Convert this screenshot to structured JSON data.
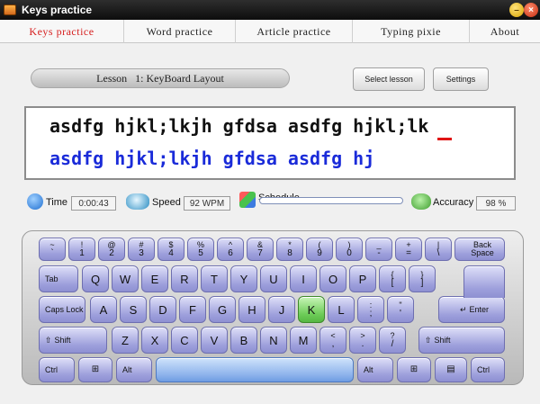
{
  "app": {
    "title": "Keys practice"
  },
  "tabs": [
    {
      "label": "Keys practice",
      "active": true
    },
    {
      "label": "Word practice",
      "active": false
    },
    {
      "label": "Article practice",
      "active": false
    },
    {
      "label": "Typing pixie",
      "active": false
    },
    {
      "label": "About",
      "active": false
    }
  ],
  "lesson": {
    "text": "Lesson   1: KeyBoard Layout"
  },
  "buttons": {
    "select_lesson": "Select lesson",
    "settings": "Settings"
  },
  "practice": {
    "target_text": "asdfg hjkl;lkjh gfdsa asdfg hjkl;lk",
    "typed_text": "asdfg hjkl;lkjh gfdsa asdfg hj"
  },
  "stats": {
    "time_label": "Time",
    "time_value": "0:00:43",
    "speed_label": "Speed",
    "speed_value": "92 WPM",
    "schedule_label": "Schedule",
    "schedule_progress": 0.0,
    "accuracy_label": "Accuracy",
    "accuracy_value": "98 %"
  },
  "keyboard": {
    "highlighted_key": "K",
    "row1": [
      {
        "top": "~",
        "bottom": "`"
      },
      {
        "top": "!",
        "bottom": "1"
      },
      {
        "top": "@",
        "bottom": "2"
      },
      {
        "top": "#",
        "bottom": "3"
      },
      {
        "top": "$",
        "bottom": "4"
      },
      {
        "top": "%",
        "bottom": "5"
      },
      {
        "top": "^",
        "bottom": "6"
      },
      {
        "top": "&",
        "bottom": "7"
      },
      {
        "top": "*",
        "bottom": "8"
      },
      {
        "top": "(",
        "bottom": "9"
      },
      {
        "top": ")",
        "bottom": "0"
      },
      {
        "top": "_",
        "bottom": "-"
      },
      {
        "top": "+",
        "bottom": "="
      },
      {
        "top": "|",
        "bottom": "\\"
      }
    ],
    "backspace": "Back Space",
    "tab": "Tab",
    "row2": [
      "Q",
      "W",
      "E",
      "R",
      "T",
      "Y",
      "U",
      "I",
      "O",
      "P"
    ],
    "row2_extra": [
      {
        "top": "{",
        "bottom": "["
      },
      {
        "top": "}",
        "bottom": "]"
      }
    ],
    "caps": "Caps Lock",
    "row3": [
      "A",
      "S",
      "D",
      "F",
      "G",
      "H",
      "J",
      "K",
      "L"
    ],
    "row3_extra": [
      {
        "top": ":",
        "bottom": ";"
      },
      {
        "top": "\"",
        "bottom": "'"
      }
    ],
    "enter": "Enter",
    "shift_left": "Shift",
    "row4": [
      "Z",
      "X",
      "C",
      "V",
      "B",
      "N",
      "M"
    ],
    "row4_extra": [
      {
        "top": "<",
        "bottom": ","
      },
      {
        "top": ">",
        "bottom": "."
      },
      {
        "top": "?",
        "bottom": "/"
      }
    ],
    "shift_right": "Shift",
    "ctrl_left": "Ctrl",
    "alt_left": "Alt",
    "alt_right": "Alt",
    "ctrl_right": "Ctrl"
  },
  "colors": {
    "accent_tab": "#d62020",
    "typed_text": "#1a2bd9",
    "active_key": "#6ccb57",
    "cursor": "#e01414"
  }
}
